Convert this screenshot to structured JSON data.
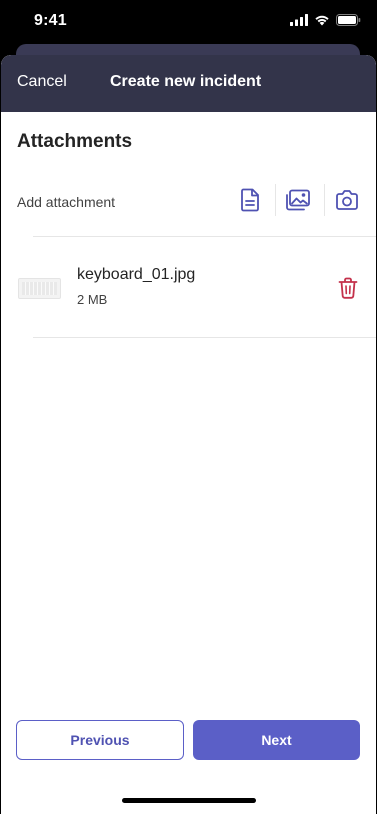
{
  "status_bar": {
    "time": "9:41",
    "icons": [
      "cellular-signal-icon",
      "wifi-icon",
      "battery-icon"
    ]
  },
  "header": {
    "cancel_label": "Cancel",
    "title": "Create new incident"
  },
  "attachments": {
    "section_title": "Attachments",
    "add_label": "Add attachment",
    "add_buttons": [
      "document-icon",
      "gallery-icon",
      "camera-icon"
    ]
  },
  "files": [
    {
      "name": "keyboard_01.jpg",
      "size": "2 MB",
      "thumbnail": "keyboard-thumbnail"
    }
  ],
  "footer": {
    "previous_label": "Previous",
    "next_label": "Next"
  },
  "colors": {
    "header_bg": "#33344a",
    "accent": "#5b5fc7",
    "delete": "#c4314b"
  }
}
